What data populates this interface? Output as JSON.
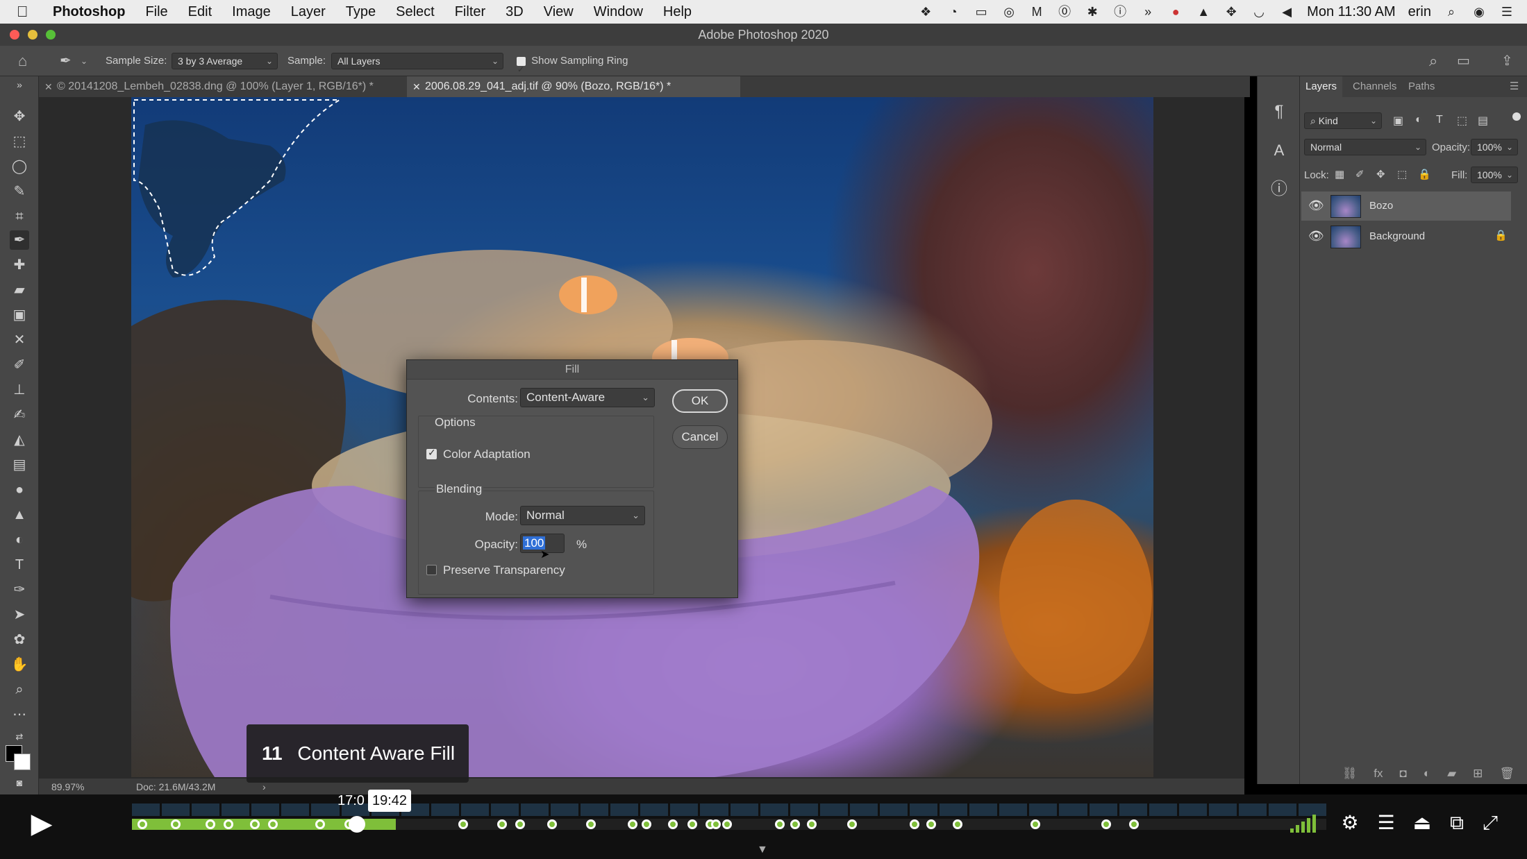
{
  "menubar": {
    "app_name": "Photoshop",
    "items": [
      "File",
      "Edit",
      "Image",
      "Layer",
      "Type",
      "Select",
      "Filter",
      "3D",
      "View",
      "Window",
      "Help"
    ],
    "clock": "Mon 11:30 AM",
    "user": "erin"
  },
  "window": {
    "title": "Adobe Photoshop 2020"
  },
  "options_bar": {
    "sample_size_label": "Sample Size:",
    "sample_size_value": "3 by 3 Average",
    "sample_label": "Sample:",
    "sample_value": "All Layers",
    "show_sampling_ring_label": "Show Sampling Ring",
    "show_sampling_ring_checked": true
  },
  "tabs": [
    {
      "label": "© 20141208_Lembeh_02838.dng @ 100% (Layer 1, RGB/16*) *",
      "active": false
    },
    {
      "label": "2006.08.29_041_adj.tif @ 90% (Bozo, RGB/16*) *",
      "active": true
    }
  ],
  "fill_dialog": {
    "title": "Fill",
    "contents_label": "Contents:",
    "contents_value": "Content-Aware",
    "options_heading": "Options",
    "color_adaptation_label": "Color Adaptation",
    "color_adaptation_checked": true,
    "blending_heading": "Blending",
    "mode_label": "Mode:",
    "mode_value": "Normal",
    "opacity_label": "Opacity:",
    "opacity_value": "100",
    "opacity_unit": "%",
    "preserve_transparency_label": "Preserve Transparency",
    "preserve_transparency_checked": false,
    "ok_label": "OK",
    "cancel_label": "Cancel"
  },
  "layers_panel": {
    "tabs": [
      "Layers",
      "Channels",
      "Paths"
    ],
    "filter_kind": "Kind",
    "blend_mode": "Normal",
    "opacity_label": "Opacity:",
    "opacity_value": "100%",
    "lock_label": "Lock:",
    "fill_label": "Fill:",
    "fill_value": "100%",
    "layers": [
      {
        "name": "Bozo",
        "selected": true,
        "locked": false
      },
      {
        "name": "Background",
        "selected": false,
        "locked": true
      }
    ]
  },
  "status_bar": {
    "zoom": "89.97%",
    "doc_info": "Doc: 21.6M/43.2M"
  },
  "video": {
    "chapter_number": "11",
    "chapter_title": "Content Aware Fill",
    "current_time": "17:0",
    "hover_time": "19:42",
    "progress_fraction": 0.26
  },
  "colors": {
    "accent_progress": "#7fbf3a",
    "selection_highlight": "#2f6fd6"
  }
}
